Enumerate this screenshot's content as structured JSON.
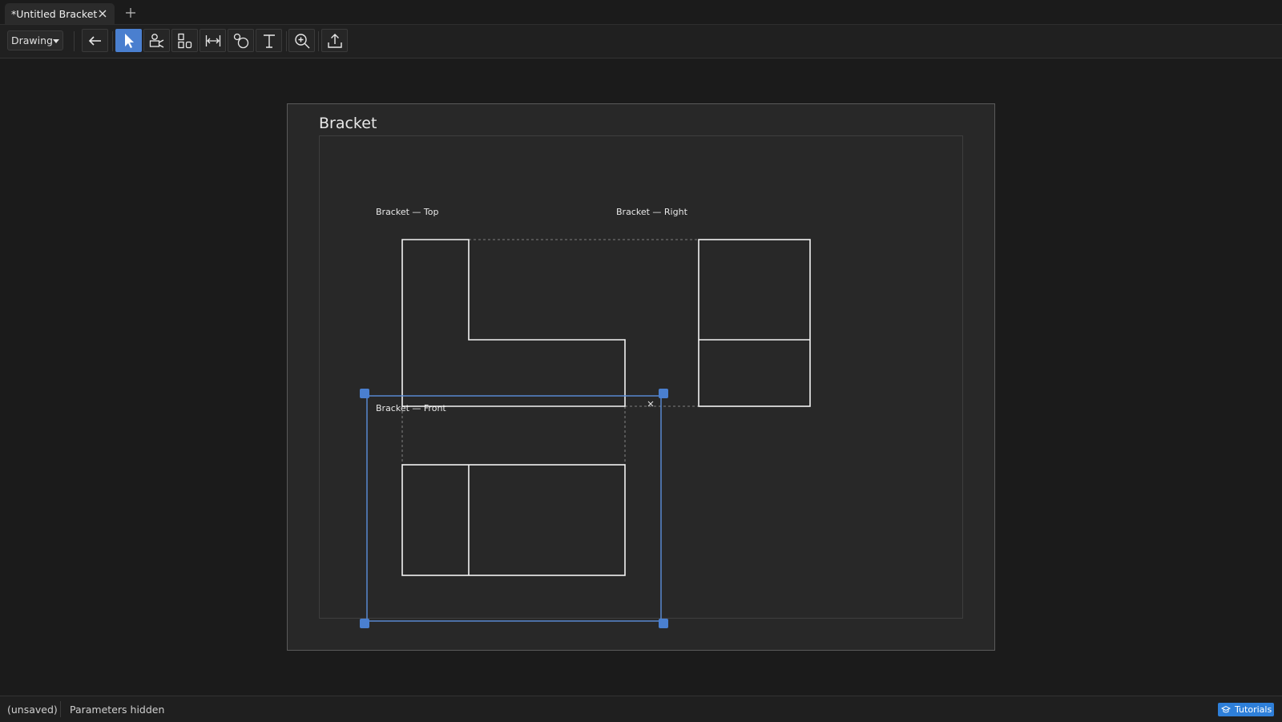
{
  "tabs": [
    {
      "label": "*Untitled Bracket",
      "active": true
    }
  ],
  "toolbar": {
    "mode_label": "Drawing",
    "tools": [
      {
        "name": "back-button",
        "icon": "arrow-left-icon",
        "active": false
      },
      {
        "name": "select-tool",
        "icon": "cursor-arrow-icon",
        "active": true
      },
      {
        "name": "insert-view-tool",
        "icon": "camera-view-icon",
        "active": false
      },
      {
        "name": "projected-views-tool",
        "icon": "views-grid-icon",
        "active": false
      },
      {
        "name": "dimension-tool",
        "icon": "dimension-icon",
        "active": false
      },
      {
        "name": "annotation-tool",
        "icon": "balloon-circle-icon",
        "active": false
      },
      {
        "name": "text-tool",
        "icon": "text-cursor-icon",
        "active": false
      },
      {
        "name": "zoom-tool",
        "icon": "zoom-in-icon",
        "active": false
      },
      {
        "name": "export-tool",
        "icon": "upload-icon",
        "active": false
      }
    ]
  },
  "sheet": {
    "title": "Bracket",
    "views": [
      {
        "label": "Bracket — Top"
      },
      {
        "label": "Bracket — Right"
      },
      {
        "label": "Bracket — Front",
        "selected": true
      }
    ]
  },
  "status": {
    "save_state": "(unsaved)",
    "parameters": "Parameters hidden",
    "tutorials_label": "Tutorials"
  },
  "colors": {
    "background": "#1b1b1b",
    "sheet": "#282828",
    "accent": "#4a7fcf",
    "selection": "#5b8fdc",
    "tutorials": "#2e7fd9"
  }
}
